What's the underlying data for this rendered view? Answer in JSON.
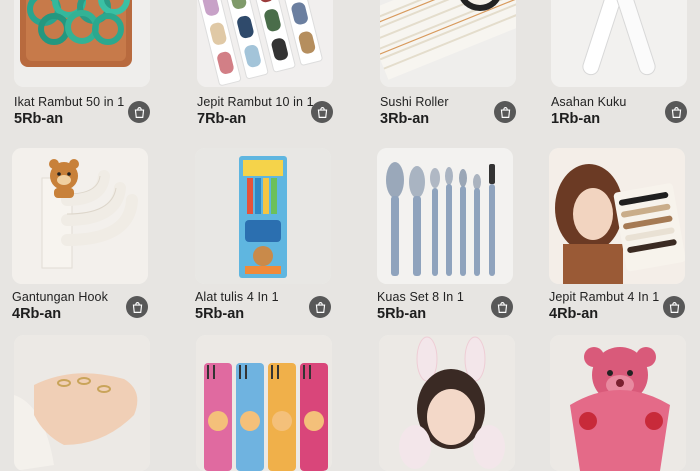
{
  "products": [
    {
      "name": "Ikat Rambut 50 in 1",
      "price": "5Rb-an",
      "image": "teal hair ties in wooden tray"
    },
    {
      "name": "Jepit Rambut 10 in 1",
      "price": "7Rb-an",
      "image": "colorful hair clips"
    },
    {
      "name": "Sushi Roller",
      "price": "3Rb-an",
      "image": "bamboo sushi mat"
    },
    {
      "name": "Asahan Kuku",
      "price": "1Rb-an",
      "image": "clear nail files"
    },
    {
      "name": "Gantungan Hook",
      "price": "4Rb-an",
      "image": "bear wall hook"
    },
    {
      "name": "Alat tulis 4 In 1",
      "price": "5Rb-an",
      "image": "stationery set"
    },
    {
      "name": "Kuas Set 8 In 1",
      "price": "5Rb-an",
      "image": "makeup brush set"
    },
    {
      "name": "Jepit Rambut 4 In 1",
      "price": "4Rb-an",
      "image": "hair clips on model"
    },
    {
      "name": "",
      "price": "",
      "image": "rings on hand"
    },
    {
      "name": "",
      "price": "",
      "image": "colored pencils"
    },
    {
      "name": "",
      "price": "",
      "image": "bunny ear headband"
    },
    {
      "name": "",
      "price": "",
      "image": "pink bear plush clip"
    }
  ],
  "icons": {
    "cart": "shopping-bag-icon"
  },
  "colors": {
    "background": "#e7e5e2",
    "cart_button": "#585858"
  }
}
